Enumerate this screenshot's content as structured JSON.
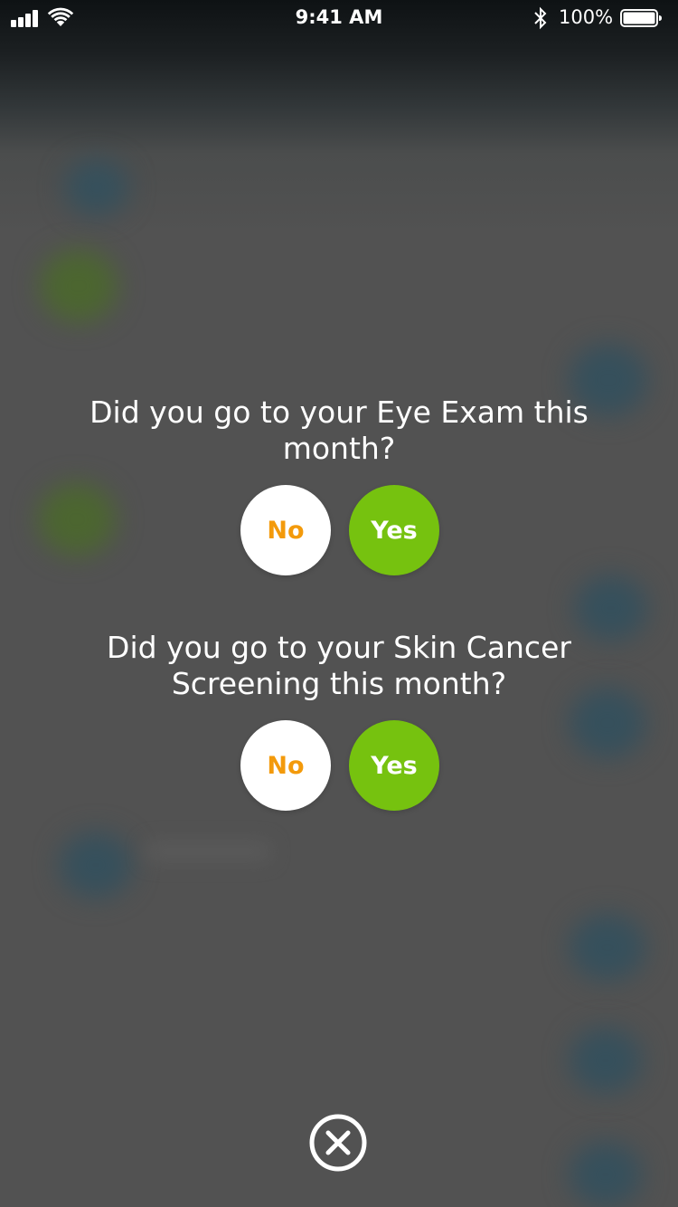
{
  "colors": {
    "no_text": "#f39a0b",
    "yes_background": "#76c20f",
    "overlay_background": "#525252",
    "text": "#ffffff"
  },
  "status_bar": {
    "time": "9:41 AM",
    "battery_percent": "100%",
    "battery_level": 1.0,
    "icons": [
      "signal-icon",
      "wifi-icon",
      "bluetooth-icon",
      "battery-icon"
    ]
  },
  "questions": [
    {
      "text": "Did you go to your Eye Exam this month?",
      "no_label": "No",
      "yes_label": "Yes"
    },
    {
      "text": "Did you go to your Skin Cancer Screening this month?",
      "no_label": "No",
      "yes_label": "Yes"
    }
  ],
  "close_button": {
    "icon": "close-circle-icon"
  }
}
